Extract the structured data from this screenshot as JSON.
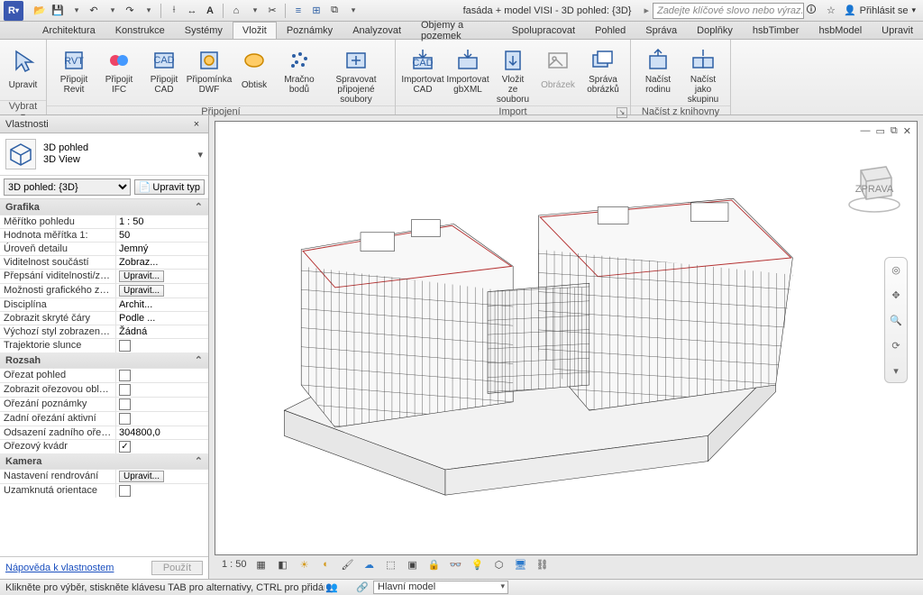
{
  "app_icon_letter": "R",
  "doc_title": "fasáda + model VISI - 3D pohled: {3D}",
  "search_placeholder": "Zadejte klíčové slovo nebo výraz.",
  "signin_label": "Přihlásit se",
  "menu_tabs": [
    "Architektura",
    "Konstrukce",
    "Systémy",
    "Vložit",
    "Poznámky",
    "Analyzovat",
    "Objemy a pozemek",
    "Spolupracovat",
    "Pohled",
    "Správa",
    "Doplňky",
    "hsbTimber",
    "hsbModel",
    "Upravit"
  ],
  "menu_active_index": 3,
  "ribbon": {
    "select_group": {
      "modify": "Upravit",
      "caption": "Vybrat"
    },
    "pripojeni": {
      "caption": "Připojení",
      "items": [
        {
          "id": "link-revit",
          "l": "Připojit\nRevit"
        },
        {
          "id": "link-ifc",
          "l": "Připojit\nIFC"
        },
        {
          "id": "link-cad",
          "l": "Připojit\nCAD"
        },
        {
          "id": "dwf-markup",
          "l": "Připomínka\nDWF"
        },
        {
          "id": "decal",
          "l": "Obtisk\n "
        },
        {
          "id": "point-cloud",
          "l": "Mračno\nbodů"
        },
        {
          "id": "manage-links",
          "l": "Spravovat\npřipojené soubory"
        }
      ]
    },
    "import": {
      "caption": "Import",
      "items": [
        {
          "id": "import-cad",
          "l": "Importovat\nCAD"
        },
        {
          "id": "import-gbxml",
          "l": "Importovat\ngbXML"
        },
        {
          "id": "insert-file",
          "l": "Vložit\nze souboru"
        },
        {
          "id": "image",
          "l": "Obrázek",
          "disabled": true
        },
        {
          "id": "manage-images",
          "l": "Správa\nobrázků"
        }
      ]
    },
    "loadlib": {
      "caption": "Načíst z knihovny",
      "items": [
        {
          "id": "load-family",
          "l": "Načíst\nrodinu"
        },
        {
          "id": "load-group",
          "l": "Načíst jako\nskupinu"
        }
      ]
    }
  },
  "panel": {
    "title": "Vlastnosti",
    "type_line1": "3D pohled",
    "type_line2": "3D View",
    "instance": "3D pohled: {3D}",
    "edit_type": "Upravit typ",
    "help_link": "Nápověda k vlastnostem",
    "apply": "Použít",
    "groups": [
      {
        "name": "Grafika",
        "rows": [
          {
            "k": "Měřítko pohledu",
            "v": "1 : 50",
            "type": "text"
          },
          {
            "k": "Hodnota měřítka   1:",
            "v": "50",
            "type": "ro"
          },
          {
            "k": "Úroveň detailu",
            "v": "Jemný",
            "type": "ro"
          },
          {
            "k": "Viditelnost součástí",
            "v": "Zobraz...",
            "type": "ro"
          },
          {
            "k": "Přepsání viditelnosti/zobrazení",
            "v": "Upravit...",
            "type": "btn"
          },
          {
            "k": "Možnosti grafického zobrazení",
            "v": "Upravit...",
            "type": "btn"
          },
          {
            "k": "Disciplína",
            "v": "Archit...",
            "type": "ro"
          },
          {
            "k": "Zobrazit skryté čáry",
            "v": "Podle ...",
            "type": "ro"
          },
          {
            "k": "Výchozí styl zobrazení analýzy",
            "v": "Žádná",
            "type": "ro"
          },
          {
            "k": "Trajektorie slunce",
            "v": "",
            "type": "chk",
            "checked": false
          }
        ]
      },
      {
        "name": "Rozsah",
        "rows": [
          {
            "k": "Ořezat pohled",
            "v": "",
            "type": "chk",
            "checked": false
          },
          {
            "k": "Zobrazit ořezovou oblast",
            "v": "",
            "type": "chk",
            "checked": false
          },
          {
            "k": "Ořezání poznámky",
            "v": "",
            "type": "chk",
            "checked": false
          },
          {
            "k": "Zadní ořezání aktivní",
            "v": "",
            "type": "chk",
            "checked": false
          },
          {
            "k": "Odsazení zadního ořezání",
            "v": "304800,0",
            "type": "ro"
          },
          {
            "k": "Ořezový kvádr",
            "v": "",
            "type": "chk",
            "checked": true
          }
        ]
      },
      {
        "name": "Kamera",
        "rows": [
          {
            "k": "Nastavení rendrování",
            "v": "Upravit...",
            "type": "btn"
          },
          {
            "k": "Uzamknutá orientace",
            "v": "",
            "type": "chk",
            "checked": false
          }
        ]
      }
    ]
  },
  "view_controls": {
    "scale": "1 : 50"
  },
  "status": {
    "hint": "Klikněte pro výběr, stiskněte klávesu TAB pro alternativy, CTRL pro přidán",
    "workset": "Hlavní model"
  }
}
